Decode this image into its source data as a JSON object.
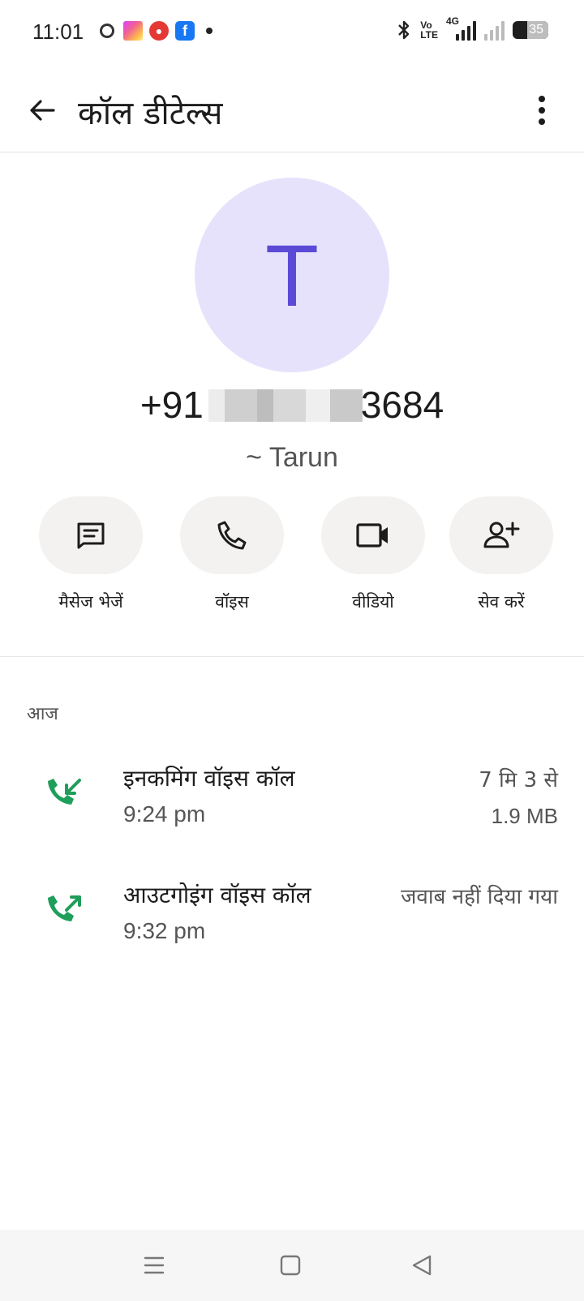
{
  "status_bar": {
    "time": "11:01",
    "volte_line1": "Vo",
    "volte_line2": "LTE",
    "network": "4G",
    "battery": "35"
  },
  "app_bar": {
    "title": "कॉल डीटेल्स",
    "back_icon": "arrow-back-icon",
    "more_icon": "more-vert-icon"
  },
  "contact": {
    "avatar_letter": "T",
    "avatar_bg": "#e6e2fc",
    "avatar_fg": "#5a4ad6",
    "phone_prefix": "+91",
    "phone_suffix": "3684",
    "nickname": "~ Tarun"
  },
  "actions": [
    {
      "label": "मैसेज भेजें",
      "icon": "message-icon"
    },
    {
      "label": "वॉइस",
      "icon": "phone-icon"
    },
    {
      "label": "वीडियो",
      "icon": "videocam-icon"
    },
    {
      "label": "सेव करें",
      "icon": "person-add-icon"
    }
  ],
  "history": {
    "section_label": "आज",
    "accent_color": "#1e9e5a",
    "calls": [
      {
        "type": "इनकमिंग वॉइस कॉल",
        "time": "9:24 pm",
        "duration": "7 मि 3 से",
        "size": "1.9 MB",
        "icon": "call-received-icon"
      },
      {
        "type": "आउटगोइंग वॉइस कॉल",
        "time": "9:32 pm",
        "status": "जवाब नहीं दिया गया",
        "icon": "call-made-icon"
      }
    ]
  },
  "nav_bar": {
    "recents_icon": "menu-icon",
    "home_icon": "home-square-icon",
    "back_icon": "nav-back-triangle-icon"
  }
}
